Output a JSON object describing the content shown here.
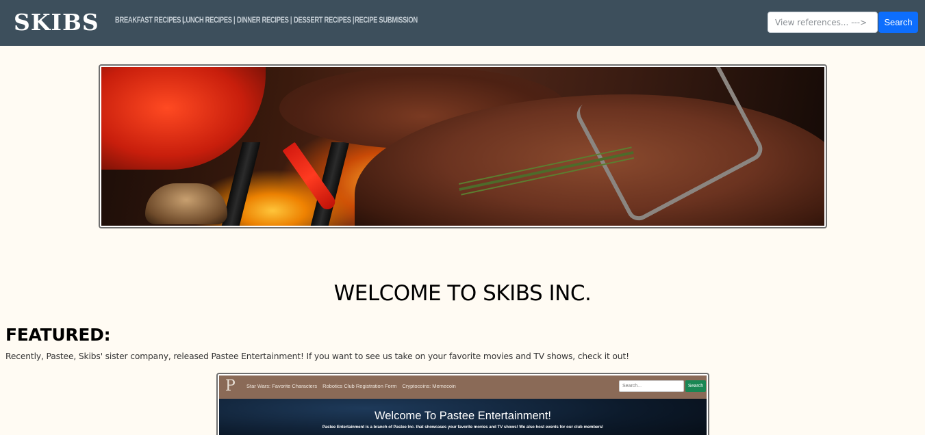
{
  "header": {
    "brand": "SKIBS",
    "nav": [
      {
        "label": "BREAKFAST RECIPES |"
      },
      {
        "label": "LUNCH RECIPES |"
      },
      {
        "label": "DINNER RECIPES |"
      },
      {
        "label": "DESSERT RECIPES |"
      },
      {
        "label": "RECIPE SUBMISSION"
      }
    ],
    "search": {
      "placeholder": "View references... --->",
      "button_label": "Search"
    }
  },
  "hero": {
    "image": "grilled steak with peppers and rosemary banner"
  },
  "main": {
    "welcome": "WELCOME TO SKIBS INC.",
    "featured_heading": "FEATURED:",
    "featured_text": "Recently, Pastee, Skibs' sister company, released Pastee Entertainment! If you want to see us take on your favorite movies and TV shows, check it out!"
  },
  "preview": {
    "logo": "P",
    "nav": [
      "Star Wars: Favorite Characters",
      "Robotics Club Registration Form",
      "Cryptocoins: Memecoin"
    ],
    "search_placeholder": "Search...",
    "search_button": "Search",
    "title": "Welcome To Pastee Entertainment!",
    "subtitle": "Pastee Entertainment is a branch of Pastee Inc. that showcases your favorite movies and TV shows! We also host events for our club members!"
  },
  "colors": {
    "navbar": "#3d4f5c",
    "page_bg": "#fffbf3",
    "search_button": "#0d6efd",
    "preview_nav": "#8a6a57",
    "preview_button": "#198754"
  }
}
